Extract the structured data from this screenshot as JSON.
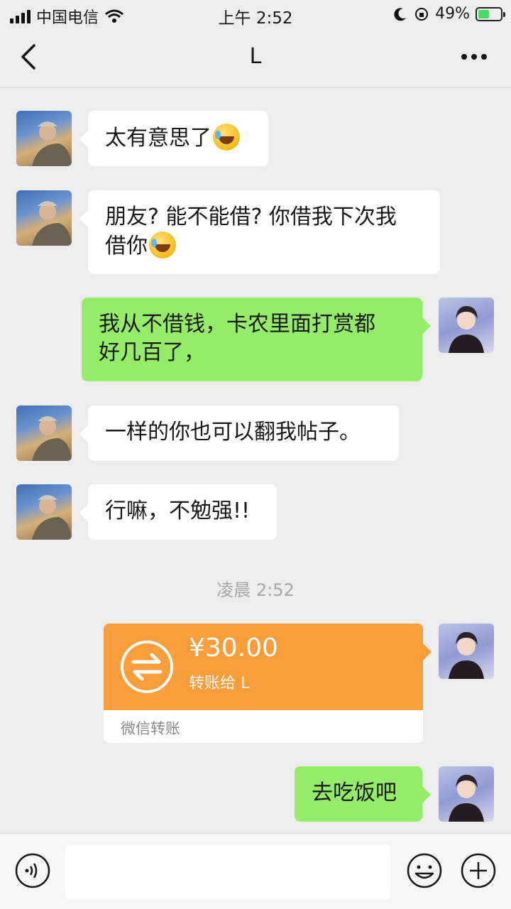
{
  "status_bar": {
    "carrier": "中国电信",
    "time": "上午 2:52",
    "battery_percent": "49%",
    "battery_level": 0.49
  },
  "nav": {
    "title": "L"
  },
  "messages": [
    {
      "direction": "received",
      "text": "太有意思了",
      "emoji": "laughing-crying-emoji"
    },
    {
      "direction": "received",
      "text_line1": "朋友? 能不能借? 你借我下次我",
      "text_line2": "借你",
      "emoji": "laughing-crying-emoji"
    },
    {
      "direction": "sent",
      "text_line1": "我从不借钱，卡农里面打赏都",
      "text_line2": "好几百了，"
    },
    {
      "direction": "received",
      "text": "一样的你也可以翻我帖子。"
    },
    {
      "direction": "received",
      "text": "行嘛，不勉强!!"
    },
    {
      "direction": "sent",
      "text": "去吃饭吧"
    }
  ],
  "timestamp": "凌晨 2:52",
  "transfer": {
    "amount": "¥30.00",
    "description": "转账给 L",
    "footer": "微信转账",
    "color": "#fa9d3b"
  },
  "input_bar": {
    "value": ""
  },
  "colors": {
    "sent_bubble": "#95ec69",
    "received_bubble": "#ffffff",
    "background": "#ededed"
  }
}
